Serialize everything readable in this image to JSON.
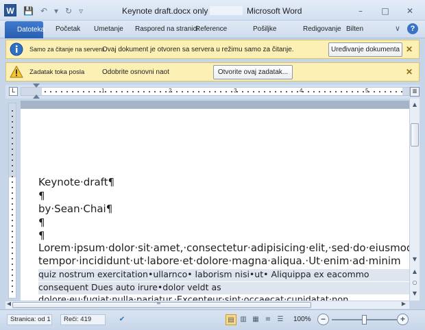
{
  "titlebar": {
    "app_icon": "W",
    "doc_title": "Keynote draft.docx only -",
    "app_name": "Microsoft Word",
    "qat": {
      "save": "💾",
      "undo": "↶",
      "undo_menu": "▾",
      "redo": "↻",
      "customize": "▿"
    },
    "window": {
      "minimize": "–",
      "restore": "□",
      "close": "✕"
    }
  },
  "ribbon": {
    "tabs": [
      "Datoteka",
      "Početak",
      "Umetanje",
      "Raspored na stranici",
      "Reference",
      "Pošiljke",
      "Redigovanje",
      "Bilten"
    ],
    "minimize_ribbon": "∨",
    "help": "?"
  },
  "message_bars": [
    {
      "icon": "info-icon",
      "title": "Samo za čitanje na serveru",
      "text": "Ovaj dokument je otvoren sa servera u režimu samo za čitanje.",
      "button": "Uređivanje dokumenta",
      "close": "✕"
    },
    {
      "icon": "warning-icon",
      "title": "Zadatak toka posla",
      "text": "Odobrite osnovni naot",
      "button": "Otvorite ovaj zadatak...",
      "close": "✕"
    }
  ],
  "ruler": {
    "tab_selector": "L",
    "numbers": [
      "1",
      "2",
      "3",
      "4",
      "5"
    ],
    "toggle": "≣"
  },
  "document": {
    "lines": [
      "Keynote·draft¶",
      "¶",
      "by·Sean·Chai¶",
      "¶",
      "¶",
      "Lorem·ipsum·dolor·sit·amet,·consectetur·adipisicing·elit,·sed·do·eiusmod",
      "tempor·incididunt·ut·labore·et·dolore·magna·aliqua.·Ut·enim·ad·minim"
    ],
    "highlighted_lines": [
      "quiz nostrum exercitation•ullarnco• laborism nisi•ut• Aliquippa ex eacommo",
      "consequent Dues auto irure•dolor veldt as"
    ],
    "cut_line": "dolore·eu·fugiat·nulla·pariatur.·Excepteur·sint·occaecat·cupidatat·non"
  },
  "scrollbar": {
    "up": "▲",
    "down": "▼",
    "prev": "▲",
    "browse": "○",
    "next": "▼",
    "left": "◀",
    "right": "▶",
    "split": "═"
  },
  "statusbar": {
    "page_label": "Stranica: od",
    "page_value": "1",
    "words_label": "Reči: 419",
    "proof_icon": "✔",
    "views": [
      "▤",
      "▥",
      "▦",
      "≡",
      "☰"
    ],
    "zoom": "100%",
    "zoom_out": "−",
    "zoom_in": "+",
    "zoom_level": 0.5
  }
}
